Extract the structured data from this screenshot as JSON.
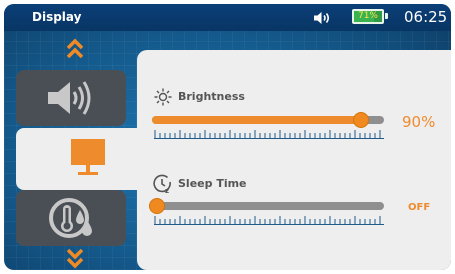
{
  "header": {
    "title": "Display",
    "volume_icon": "speaker-volume-icon",
    "battery_percent": "71%",
    "battery_level": 0.71,
    "clock": "06:25"
  },
  "menu": {
    "items": [
      {
        "name": "sound",
        "icon": "speaker-icon"
      },
      {
        "name": "display",
        "icon": "monitor-icon",
        "selected": true
      },
      {
        "name": "environment",
        "icon": "thermometer-drops-icon"
      }
    ]
  },
  "settings": {
    "brightness": {
      "label": "Brightness",
      "value_text": "90%",
      "level": 0.9
    },
    "sleep_time": {
      "label": "Sleep Time",
      "value_text": "OFF",
      "level": 0
    }
  },
  "colors": {
    "accent": "#ee8b2c",
    "header": "#0b3f78",
    "panel": "#eeeeee",
    "tile": "#4a4f56",
    "battery": "#38b34f"
  }
}
